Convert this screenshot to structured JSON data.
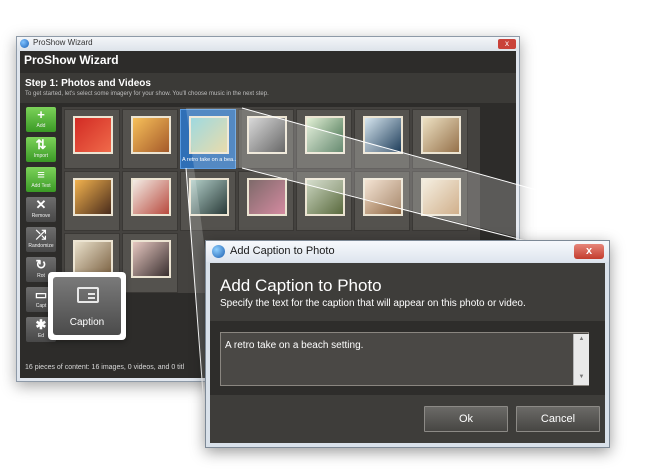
{
  "wizard": {
    "titlebar": "ProShow Wizard",
    "title": "ProShow Wizard",
    "step": "Step 1: Photos and Videos",
    "subtitle": "To get started, let's select some imagery for your show. You'll choose music in the next step.",
    "close_glyph": "x",
    "sidebar": [
      {
        "label": "Add",
        "glyph": "+",
        "icon": "plus-icon"
      },
      {
        "label": "Import",
        "glyph": "⇅",
        "icon": "import-icon"
      },
      {
        "label": "Add Text",
        "glyph": "≡",
        "icon": "add-text-icon"
      },
      {
        "label": "Remove",
        "glyph": "✕",
        "icon": "remove-icon"
      },
      {
        "label": "Randomize",
        "glyph": "⤮",
        "icon": "shuffle-icon"
      },
      {
        "label": "Rot",
        "glyph": "↻",
        "icon": "rotate-icon"
      },
      {
        "label": "Capt",
        "glyph": "▭",
        "icon": "caption-icon"
      },
      {
        "label": "Ed",
        "glyph": "✱",
        "icon": "edit-icon"
      }
    ],
    "photos": [
      {
        "caption": "",
        "colors": [
          "#d22b24",
          "#f06a4a"
        ]
      },
      {
        "caption": "",
        "colors": [
          "#f7c05a",
          "#a55a2a"
        ]
      },
      {
        "caption": "A retro take on a bea...",
        "colors": [
          "#8ad1d9",
          "#e4d49a"
        ],
        "selected": true
      },
      {
        "caption": "",
        "colors": [
          "#cfcfcf",
          "#3e3e3e"
        ]
      },
      {
        "caption": "",
        "colors": [
          "#e4f1d7",
          "#3d6b4a"
        ]
      },
      {
        "caption": "",
        "colors": [
          "#d7e6ef",
          "#1f3e5b"
        ]
      },
      {
        "caption": "",
        "colors": [
          "#ede1c3",
          "#95714a"
        ]
      },
      {
        "caption": "",
        "colors": [
          "#f2b24e",
          "#4a2c1c"
        ]
      },
      {
        "caption": "",
        "colors": [
          "#f3ede6",
          "#b84a3e"
        ]
      },
      {
        "caption": "",
        "colors": [
          "#b3cfc9",
          "#2a3b39"
        ]
      },
      {
        "caption": "",
        "colors": [
          "#7e6a6a",
          "#d48aa0"
        ]
      },
      {
        "caption": "",
        "colors": [
          "#c9d4be",
          "#5a6a3e"
        ]
      },
      {
        "caption": "",
        "colors": [
          "#f1dcc7",
          "#8e6642"
        ]
      },
      {
        "caption": "",
        "colors": [
          "#f2ead8",
          "#c49a6c"
        ]
      },
      {
        "caption": "",
        "colors": [
          "#e9e0cb",
          "#7a6040"
        ]
      },
      {
        "caption": "",
        "colors": [
          "#e6c7c0",
          "#3a3030"
        ]
      }
    ],
    "status": "16 pieces of content: 16 images, 0 videos, and 0 titl"
  },
  "callout": {
    "label": "Caption",
    "icon": "caption-icon"
  },
  "dialog": {
    "titlebar": "Add Caption to Photo",
    "close_glyph": "x",
    "heading": "Add Caption to Photo",
    "description": "Specify the text for the caption that will appear on this photo or video.",
    "caption_value": "A retro take on a beach setting.",
    "scroll_up": "▲",
    "scroll_down": "▼",
    "ok_label": "Ok",
    "cancel_label": "Cancel"
  }
}
